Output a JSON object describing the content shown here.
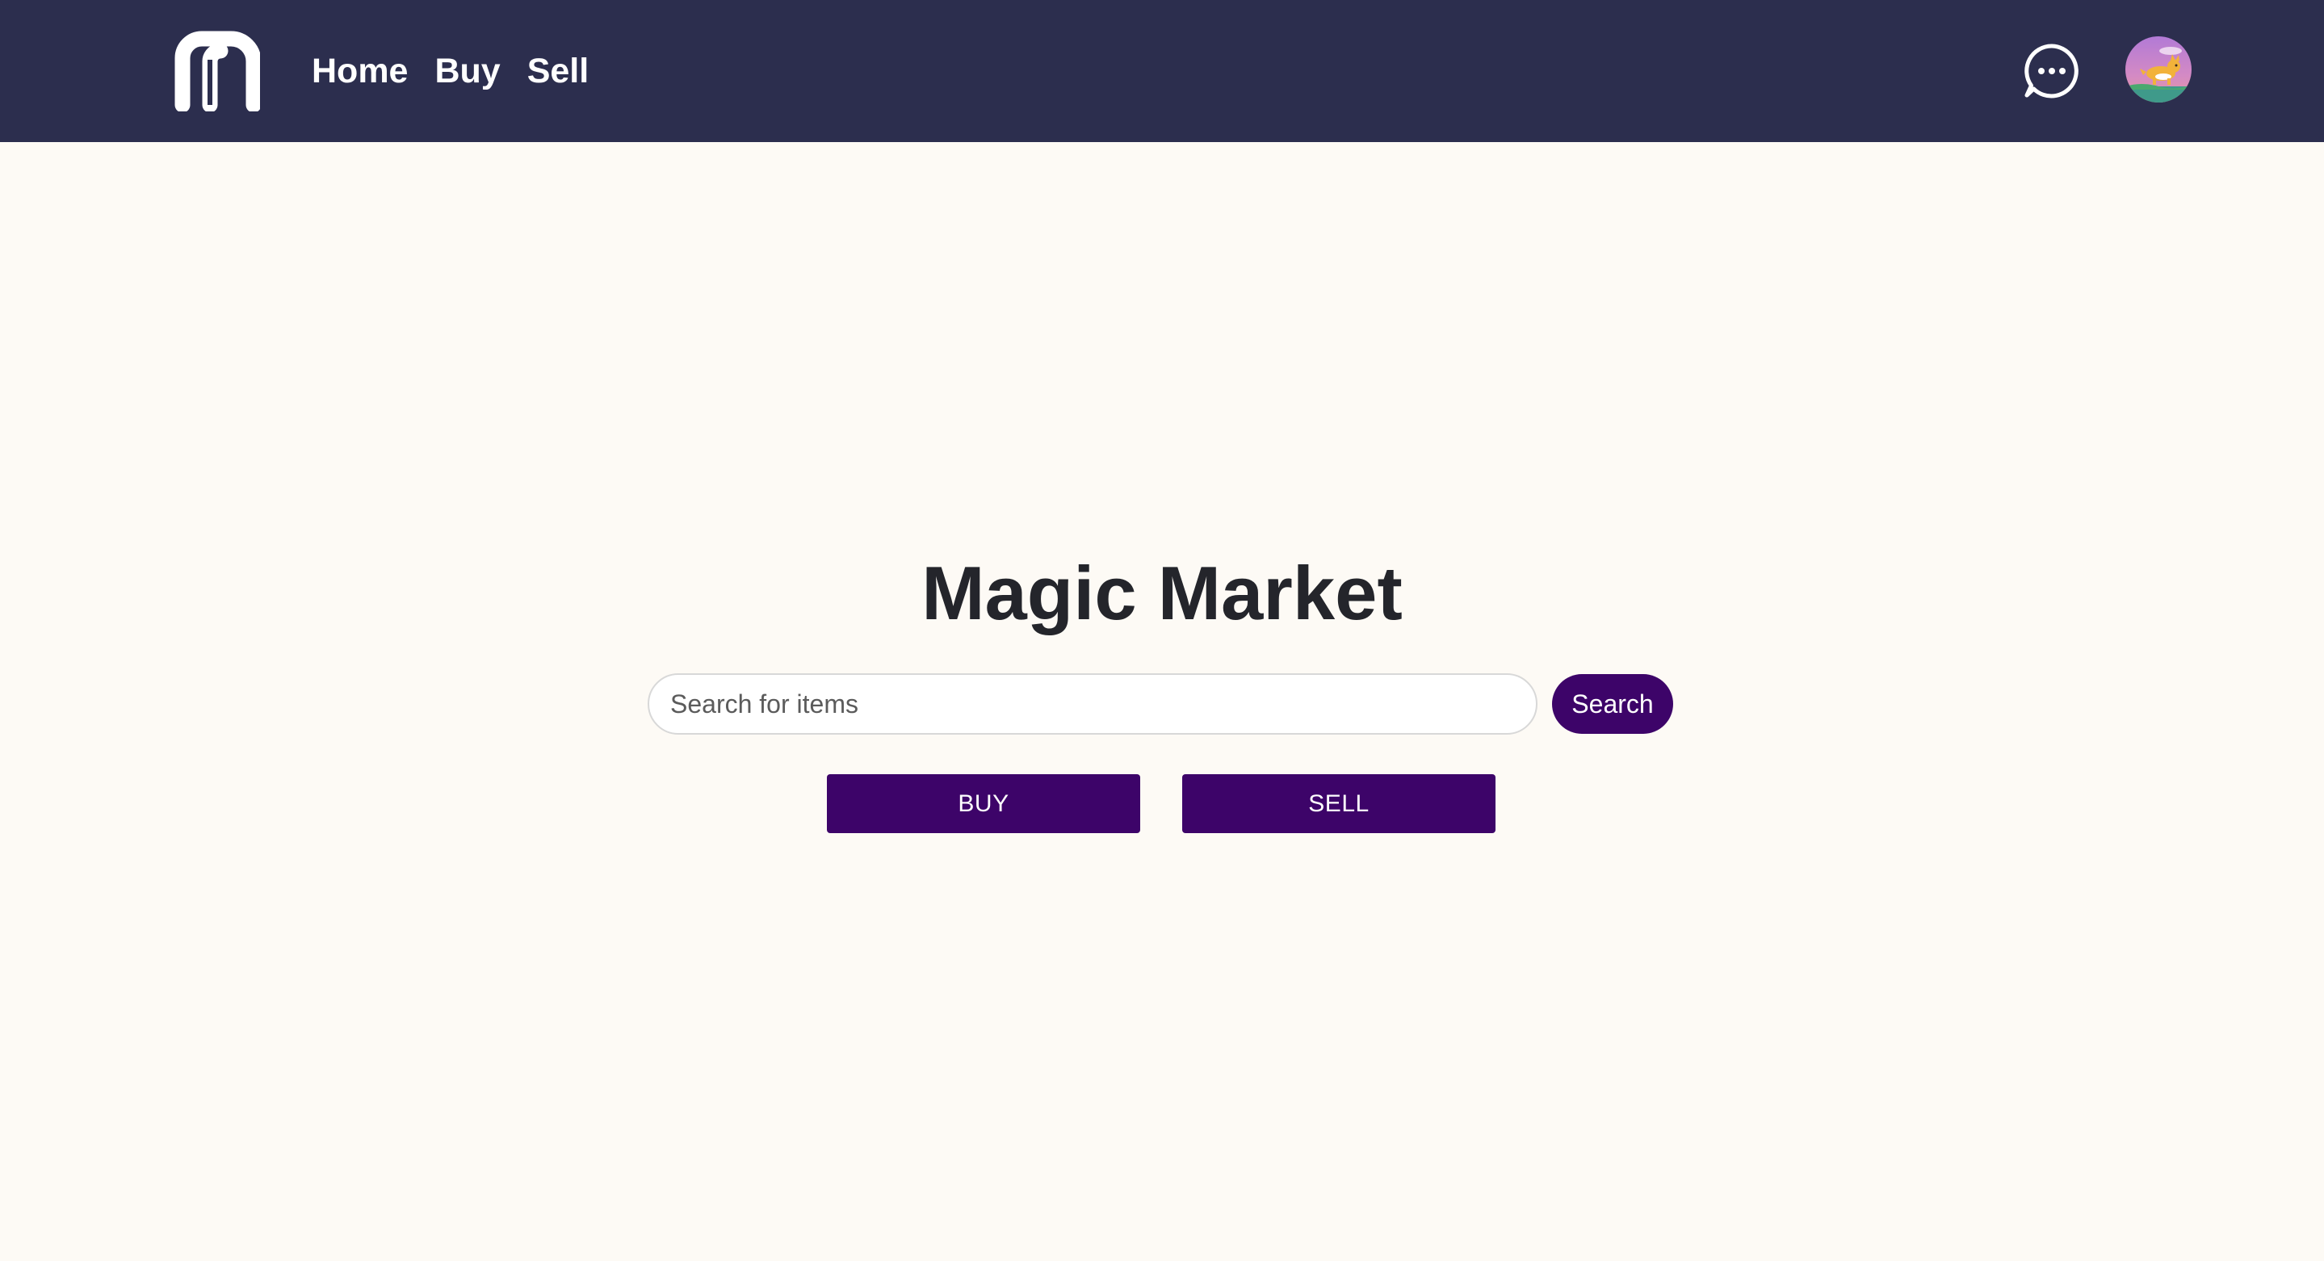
{
  "header": {
    "logo_icon": "m-logo-icon",
    "nav": [
      {
        "label": "Home"
      },
      {
        "label": "Buy"
      },
      {
        "label": "Sell"
      }
    ],
    "chat_icon": "chat-bubble-icon",
    "avatar_icon": "corgi-avatar-icon"
  },
  "hero": {
    "title": "Magic Market",
    "search": {
      "placeholder": "Search for items",
      "value": "",
      "button_label": "Search"
    },
    "buy_label": "BUY",
    "sell_label": "SELL"
  },
  "colors": {
    "header_bg": "#2c2e4e",
    "page_bg": "#fdfaf5",
    "accent": "#3d0469",
    "title_text": "#24252b"
  }
}
